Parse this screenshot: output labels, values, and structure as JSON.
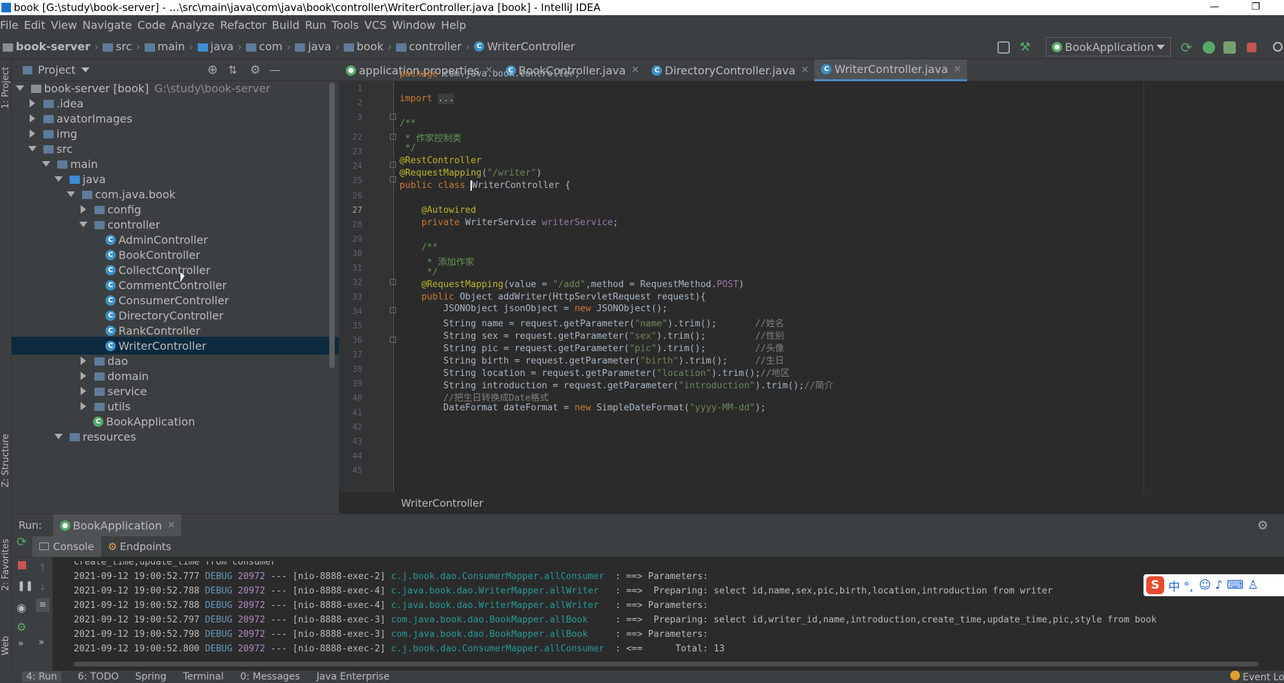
{
  "window": {
    "title": "book [G:\\study\\book-server] - ...\\src\\main\\java\\com\\java\\book\\controller\\WriterController.java [book] - IntelliJ IDEA"
  },
  "menu": [
    "File",
    "Edit",
    "View",
    "Navigate",
    "Code",
    "Analyze",
    "Refactor",
    "Build",
    "Run",
    "Tools",
    "VCS",
    "Window",
    "Help"
  ],
  "breadcrumbs": [
    "book-server",
    "src",
    "main",
    "java",
    "com",
    "java",
    "book",
    "controller",
    "WriterController"
  ],
  "run_config": "BookApplication",
  "project": {
    "title": "Project",
    "tree": [
      {
        "label": "book-server [book]",
        "path": "G:\\study\\book-server"
      },
      {
        "label": ".idea"
      },
      {
        "label": "avatorImages"
      },
      {
        "label": "img"
      },
      {
        "label": "src"
      },
      {
        "label": "main"
      },
      {
        "label": "java"
      },
      {
        "label": "com.java.book"
      },
      {
        "label": "config"
      },
      {
        "label": "controller"
      },
      {
        "label": "AdminController"
      },
      {
        "label": "BookController"
      },
      {
        "label": "CollectController"
      },
      {
        "label": "CommentController"
      },
      {
        "label": "ConsumerController"
      },
      {
        "label": "DirectoryController"
      },
      {
        "label": "RankController"
      },
      {
        "label": "WriterController"
      },
      {
        "label": "dao"
      },
      {
        "label": "domain"
      },
      {
        "label": "service"
      },
      {
        "label": "utils"
      },
      {
        "label": "BookApplication"
      },
      {
        "label": "resources"
      }
    ]
  },
  "tabs": [
    "application.properties",
    "BookController.java",
    "DirectoryController.java",
    "WriterController.java"
  ],
  "editor": {
    "line_numbers": [
      "1",
      "2",
      "3",
      "22",
      "23",
      "24",
      "25",
      "26",
      "27",
      "28",
      "29",
      "30",
      "31",
      "32",
      "33",
      "34",
      "35",
      "36",
      "37",
      "38",
      "39",
      "40",
      "41",
      "42",
      "43",
      "44",
      "45"
    ],
    "footer": "WriterController"
  },
  "run": {
    "label": "Run:",
    "tab": "BookApplication",
    "subtabs": [
      "Console",
      "Endpoints"
    ],
    "log": [
      {
        "ts": "",
        "level": "",
        "pid": "",
        "thread": "",
        "logger": "",
        "msg": " create_time,update_time from consumer"
      },
      {
        "ts": "2021-09-12 19:00:52.777",
        "level": "DEBUG",
        "pid": "20972",
        "thread": "--- [nio-8888-exec-2]",
        "logger": "c.j.book.dao.ConsumerMapper.allConsumer ",
        "msg": " : ==> Parameters: "
      },
      {
        "ts": "2021-09-12 19:00:52.788",
        "level": "DEBUG",
        "pid": "20972",
        "thread": "--- [nio-8888-exec-4]",
        "logger": "c.java.book.dao.WriterMapper.allWriter  ",
        "msg": " : ==>  Preparing: select id,name,sex,pic,birth,location,introduction from writer"
      },
      {
        "ts": "2021-09-12 19:00:52.788",
        "level": "DEBUG",
        "pid": "20972",
        "thread": "--- [nio-8888-exec-4]",
        "logger": "c.java.book.dao.WriterMapper.allWriter  ",
        "msg": " : ==> Parameters: "
      },
      {
        "ts": "2021-09-12 19:00:52.797",
        "level": "DEBUG",
        "pid": "20972",
        "thread": "--- [nio-8888-exec-3]",
        "logger": "com.java.book.dao.BookMapper.allBook    ",
        "msg": " : ==>  Preparing: select id,writer_id,name,introduction,create_time,update_time,pic,style from book"
      },
      {
        "ts": "2021-09-12 19:00:52.798",
        "level": "DEBUG",
        "pid": "20972",
        "thread": "--- [nio-8888-exec-3]",
        "logger": "com.java.book.dao.BookMapper.allBook    ",
        "msg": " : ==> Parameters: "
      },
      {
        "ts": "2021-09-12 19:00:52.800",
        "level": "DEBUG",
        "pid": "20972",
        "thread": "--- [nio-8888-exec-2]",
        "logger": "c.j.book.dao.ConsumerMapper.allConsumer ",
        "msg": " : <==      Total: 13"
      }
    ]
  },
  "bottom": [
    "4: Run",
    "6: TODO",
    "Spring",
    "Terminal",
    "0: Messages",
    "Java Enterprise",
    "Event Log"
  ],
  "side_left": [
    "1: Project",
    "Z: Structure",
    "2: Favorites",
    "Web"
  ],
  "ime": "中 °,"
}
